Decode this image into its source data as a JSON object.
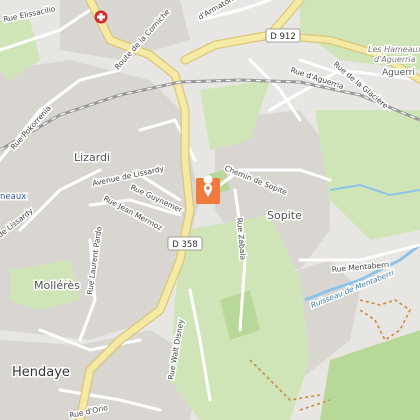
{
  "map": {
    "colors": {
      "background": "#e8e6e3",
      "urban": "#d9d6d2",
      "green": "#cfe5b8",
      "green_dark": "#b8d89a",
      "minor_road": "#ffffff",
      "main_road": "#f5e9a6",
      "main_road_casing": "#d9c676",
      "railway": "#999999",
      "water": "#8dc3e8",
      "hiking_trail": "#c98a3a",
      "marker": "#f07a3c",
      "hospital": "#d62828"
    },
    "marker_icon": "location-pin-icon",
    "hospital_icon": "hospital-cross-icon",
    "road_shields": {
      "d912": "D 912",
      "d358": "D 358"
    },
    "places": {
      "lizardi": "Lizardi",
      "sopite": "Sopite",
      "molleres": "Mollérès",
      "hendaye": "Hendaye",
      "aguerre_1": "Les Hameaux",
      "aguerre_2": "d'Aguerria",
      "aguerre_3": "Aguerri",
      "hameaux_edge": "neaux"
    },
    "streets": {
      "elissacilio": "Rue Elissacilio",
      "corniche": "Route de la Corniche",
      "armatonde": "d'Armatonde",
      "aguerria": "Rue d'Aguerria",
      "glaciere": "Rue de la Glacière",
      "pokorrenia": "Rue Pokorrenia",
      "lissardy_av": "Avenue de Lissardy",
      "gluynemer": "Rue Guynemer",
      "jean_mermoz": "Rue Jean Mermoz",
      "de_lissardy": "de Lissardy",
      "chemin_sopite": "Chemin de Sopite",
      "zabala": "Rue Zabala",
      "laurent_pardo": "Rue Laurent Pardo",
      "mentaberri": "Rue Mentaberri",
      "walt_disney": "Rue Walt Disney",
      "d_orio": "Rue d'Orio"
    },
    "water_labels": {
      "ruisseau": "Ruisseau de Mentaberri"
    }
  }
}
